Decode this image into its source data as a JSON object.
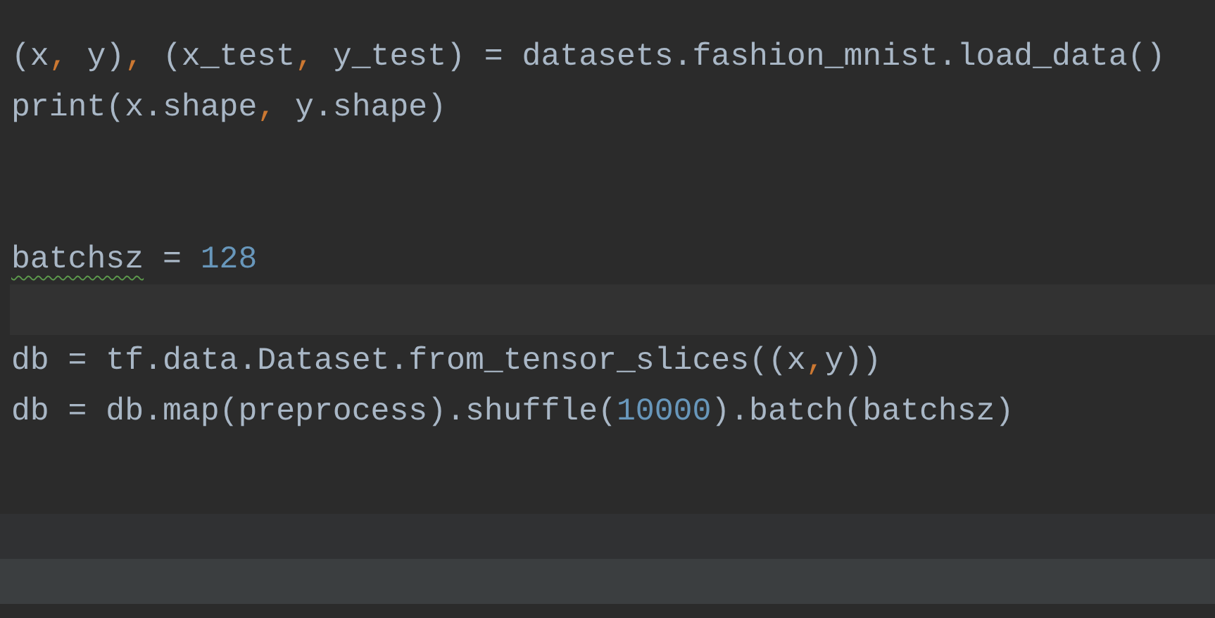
{
  "editor": {
    "lines": [
      {
        "current": false,
        "tokens": [
          {
            "kind": "plain",
            "text": "(x"
          },
          {
            "kind": "punct",
            "text": ","
          },
          {
            "kind": "plain",
            "text": " y)"
          },
          {
            "kind": "punct",
            "text": ","
          },
          {
            "kind": "plain",
            "text": " (x_test"
          },
          {
            "kind": "punct",
            "text": ","
          },
          {
            "kind": "plain",
            "text": " y_test) = datasets.fashion_mnist.load_data()"
          }
        ]
      },
      {
        "current": false,
        "tokens": [
          {
            "kind": "plain",
            "text": "print(x.shape"
          },
          {
            "kind": "punct",
            "text": ","
          },
          {
            "kind": "plain",
            "text": " y.shape)"
          }
        ]
      },
      {
        "current": false
      },
      {
        "current": false
      },
      {
        "current": false,
        "tokens": [
          {
            "kind": "plain",
            "text": "batchsz",
            "warning": true
          },
          {
            "kind": "plain",
            "text": " = "
          },
          {
            "kind": "number",
            "text": "128"
          }
        ]
      },
      {
        "current": true
      },
      {
        "current": false,
        "tokens": [
          {
            "kind": "plain",
            "text": "db = tf.data.Dataset.from_tensor_slices((x"
          },
          {
            "kind": "punct",
            "text": ","
          },
          {
            "kind": "plain",
            "text": "y))"
          }
        ]
      },
      {
        "current": false,
        "tokens": [
          {
            "kind": "plain",
            "text": "db = db.map(preprocess).shuffle("
          },
          {
            "kind": "number",
            "text": "10000"
          },
          {
            "kind": "plain",
            "text": ").batch(batchsz)"
          }
        ]
      },
      {
        "current": false
      }
    ]
  }
}
